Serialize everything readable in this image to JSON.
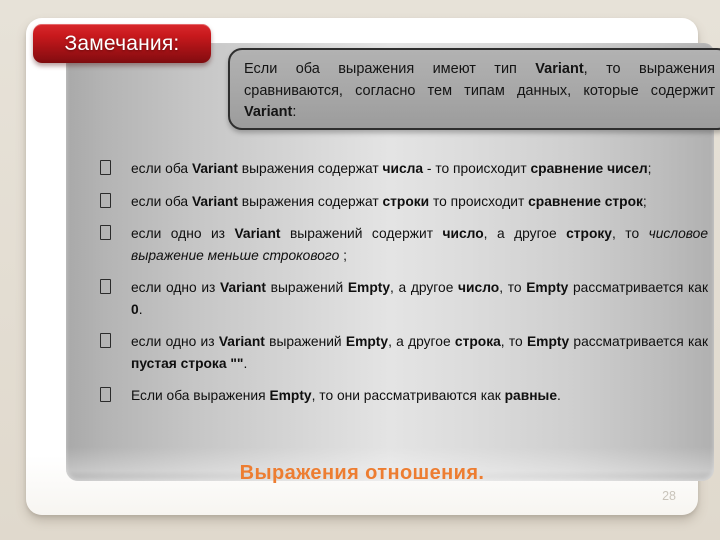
{
  "slide": {
    "badge_label": "Замечания:",
    "footer_title": "Выражения отношения.",
    "slide_number": "28",
    "accent_color": "#ed7d31",
    "badge_color": "#c8191d"
  },
  "callout": {
    "part1": "Если оба выражения имеют тип ",
    "bold1": "Variant",
    "part2": ", то выражения сравниваются, согласно тем типам данных, которые содержит ",
    "bold2": "Variant",
    "part3": ":"
  },
  "bullets": [
    {
      "glyph": "square-bullet-icon",
      "segments": [
        {
          "text": "если оба ",
          "style": "normal"
        },
        {
          "text": "Variant",
          "style": "bold"
        },
        {
          "text": " выражения содержат ",
          "style": "normal"
        },
        {
          "text": "числа",
          "style": "bold"
        },
        {
          "text": " - то происходит ",
          "style": "normal"
        },
        {
          "text": "сравнение чисел",
          "style": "bold"
        },
        {
          "text": ";",
          "style": "normal"
        }
      ]
    },
    {
      "glyph": "square-bullet-icon",
      "segments": [
        {
          "text": "если оба ",
          "style": "normal"
        },
        {
          "text": "Variant",
          "style": "bold"
        },
        {
          "text": " выражения содержат ",
          "style": "normal"
        },
        {
          "text": "строки",
          "style": "bold"
        },
        {
          "text": " то происходит ",
          "style": "normal"
        },
        {
          "text": "сравнение строк",
          "style": "bold"
        },
        {
          "text": ";",
          "style": "normal"
        }
      ]
    },
    {
      "glyph": "square-bullet-icon",
      "segments": [
        {
          "text": "если одно из ",
          "style": "normal"
        },
        {
          "text": "Variant",
          "style": "bold"
        },
        {
          "text": " выражений содержит ",
          "style": "normal"
        },
        {
          "text": "число",
          "style": "bold"
        },
        {
          "text": ", а другое ",
          "style": "normal"
        },
        {
          "text": "строку",
          "style": "bold"
        },
        {
          "text": ", то ",
          "style": "normal"
        },
        {
          "text": "числовое выражение меньше строкового",
          "style": "italic"
        },
        {
          "text": " ;",
          "style": "normal"
        }
      ]
    },
    {
      "glyph": "square-bullet-icon",
      "segments": [
        {
          "text": "если одно из ",
          "style": "normal"
        },
        {
          "text": "Variant",
          "style": "bold"
        },
        {
          "text": " выражений ",
          "style": "normal"
        },
        {
          "text": "Empty",
          "style": "bold"
        },
        {
          "text": ", а другое ",
          "style": "normal"
        },
        {
          "text": "число",
          "style": "bold"
        },
        {
          "text": ", то ",
          "style": "normal"
        },
        {
          "text": "Empty",
          "style": "bold"
        },
        {
          "text": " рассматривается как ",
          "style": "normal"
        },
        {
          "text": "0",
          "style": "bold"
        },
        {
          "text": ".",
          "style": "normal"
        }
      ]
    },
    {
      "glyph": "square-bullet-icon",
      "segments": [
        {
          "text": "если одно из ",
          "style": "normal"
        },
        {
          "text": "Variant",
          "style": "bold"
        },
        {
          "text": " выражений ",
          "style": "normal"
        },
        {
          "text": "Empty",
          "style": "bold"
        },
        {
          "text": ", а другое ",
          "style": "normal"
        },
        {
          "text": "строка",
          "style": "bold"
        },
        {
          "text": ", то ",
          "style": "normal"
        },
        {
          "text": "Empty",
          "style": "bold"
        },
        {
          "text": " рассматривается как ",
          "style": "normal"
        },
        {
          "text": "пустая строка \"\"",
          "style": "bold"
        },
        {
          "text": ".",
          "style": "normal"
        }
      ]
    },
    {
      "glyph": "square-bullet-icon",
      "segments": [
        {
          "text": "Если оба выражения ",
          "style": "normal"
        },
        {
          "text": "Empty",
          "style": "bold"
        },
        {
          "text": ", то они рассматриваются как ",
          "style": "normal"
        },
        {
          "text": "равные",
          "style": "bold"
        },
        {
          "text": ".",
          "style": "normal"
        }
      ]
    }
  ]
}
